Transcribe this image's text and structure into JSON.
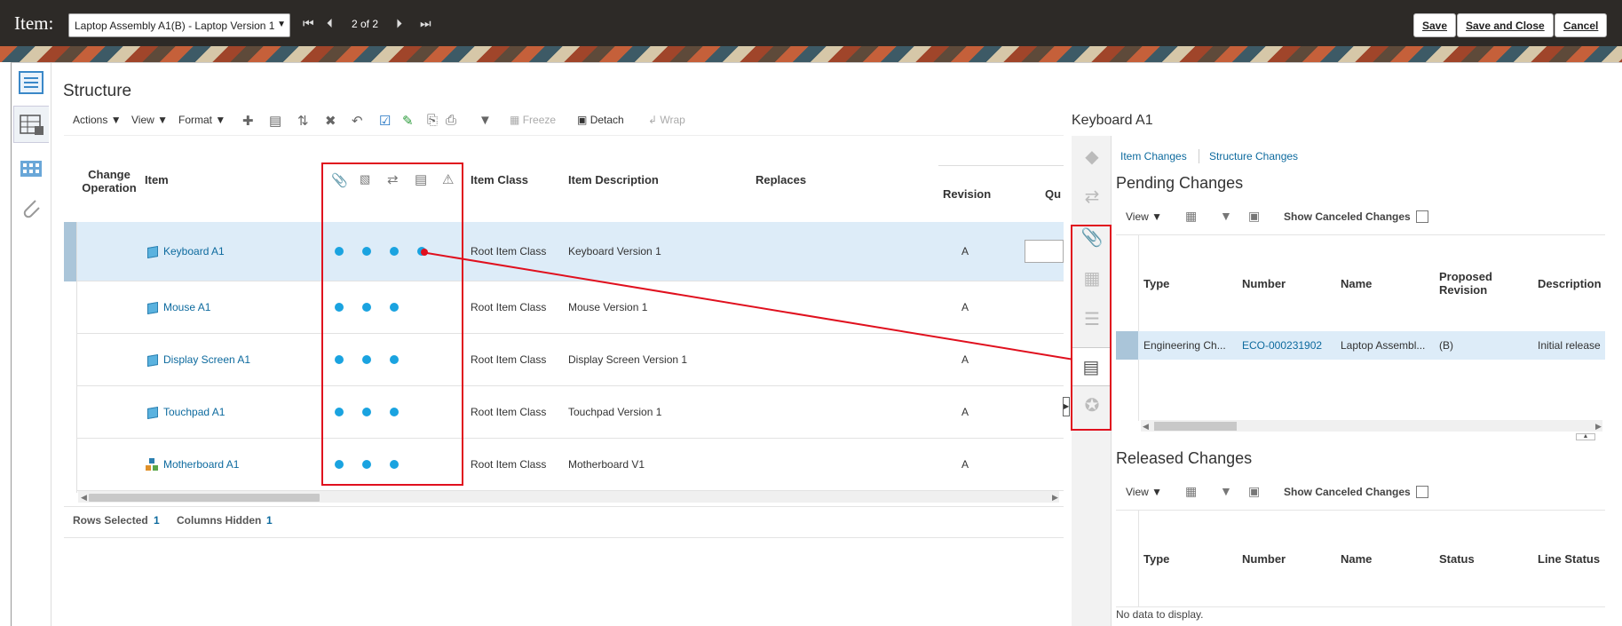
{
  "header": {
    "title": "Item:",
    "item_select_value": "Laptop Assembly A1(B) - Laptop Version 1",
    "pager": "2 of 2",
    "save_label": "Save",
    "save_close_label": "Save and Close",
    "cancel_label": "Cancel"
  },
  "structure": {
    "title": "Structure",
    "toolbar": {
      "actions": "Actions",
      "view": "View",
      "format": "Format",
      "freeze": "Freeze",
      "detach": "Detach",
      "wrap": "Wrap"
    },
    "columns": {
      "change_operation": "Change Operation",
      "item": "Item",
      "item_class": "Item Class",
      "item_description": "Item Description",
      "replaces": "Replaces",
      "revision": "Revision",
      "quantity_partial": "Qu"
    },
    "rows": [
      {
        "item": "Keyboard A1",
        "item_class": "Root Item Class",
        "description": "Keyboard Version 1",
        "revision": "A",
        "dots": 4,
        "selected": true
      },
      {
        "item": "Mouse A1",
        "item_class": "Root Item Class",
        "description": "Mouse Version 1",
        "revision": "A",
        "dots": 3,
        "selected": false
      },
      {
        "item": "Display Screen A1",
        "item_class": "Root Item Class",
        "description": "Display Screen Version 1",
        "revision": "A",
        "dots": 3,
        "selected": false
      },
      {
        "item": "Touchpad A1",
        "item_class": "Root Item Class",
        "description": "Touchpad Version 1",
        "revision": "A",
        "dots": 3,
        "selected": false
      },
      {
        "item": "Motherboard A1",
        "item_class": "Root Item Class",
        "description": "Motherboard V1",
        "revision": "A",
        "dots": 3,
        "selected": false
      }
    ],
    "footer": {
      "rows_selected_label": "Rows Selected",
      "rows_selected_value": "1",
      "columns_hidden_label": "Columns Hidden",
      "columns_hidden_value": "1"
    }
  },
  "detail": {
    "title": "Keyboard A1",
    "tabs": {
      "item_changes": "Item Changes",
      "structure_changes": "Structure Changes"
    },
    "pending": {
      "title": "Pending Changes",
      "view": "View",
      "show_canceled": "Show Canceled Changes",
      "columns": {
        "type": "Type",
        "number": "Number",
        "name": "Name",
        "proposed_revision": "Proposed Revision",
        "description": "Description"
      },
      "row": {
        "type": "Engineering Ch...",
        "number": "ECO-000231902",
        "name": "Laptop Assembl...",
        "proposed_revision": "(B)",
        "description": "Initial release"
      }
    },
    "released": {
      "title": "Released Changes",
      "view": "View",
      "show_canceled": "Show Canceled Changes",
      "columns": {
        "type": "Type",
        "number": "Number",
        "name": "Name",
        "status": "Status",
        "line_status": "Line Status"
      },
      "empty": "No data to display."
    }
  },
  "colors": {
    "accent_link": "#0d6a9e",
    "dot": "#1aa3e0",
    "highlight": "#e0101e",
    "selected_row": "#ddecf8"
  }
}
